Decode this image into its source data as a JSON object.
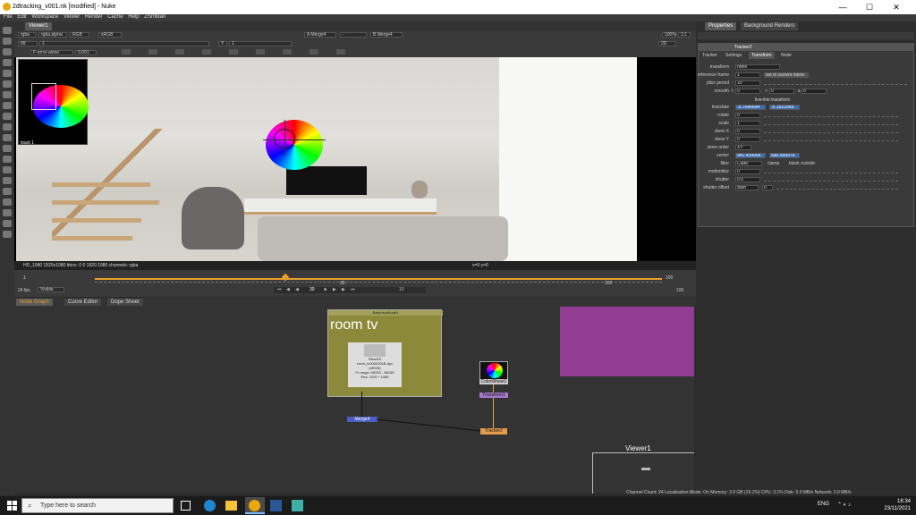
{
  "window": {
    "title": "2dtracking_v001.nk [modified] - Nuke",
    "min": "—",
    "max": "☐",
    "close": "✕"
  },
  "menu": [
    "File",
    "Edit",
    "Workspace",
    "Viewer",
    "Render",
    "Cache",
    "Help",
    "ZSmbian"
  ],
  "viewer": {
    "tab": "Viewer1",
    "channels": "rgba",
    "alpha": "rgba.alpha",
    "colorspace": "RGB",
    "display": "sRGB",
    "a_input": "A  Merge4",
    "a_op": "-",
    "b_input": "B  Merge4",
    "zoom": "100%",
    "ratio": "1:1",
    "f_stop": "f/8",
    "frame_val": "1",
    "gain": "Y",
    "gamma": "1",
    "mode": "2D",
    "proxy_mode": "F-error-alone",
    "offset": "0.001",
    "thumb_label": "track 1",
    "status_left": "HD_1080 1920x1080  bbox: 0 0 1920 1080 channels: rgba",
    "status_right": "x=0 y=0"
  },
  "timeline": {
    "fps": "24 fps",
    "visible": "Visible",
    "start": "1",
    "end": "100",
    "current": "30",
    "marks": [
      "10",
      "20",
      "30",
      "40",
      "50",
      "60",
      "70",
      "80",
      "90",
      "100"
    ],
    "in_frame": "1",
    "out_frame": "100",
    "step": "10"
  },
  "panels": {
    "tabs": [
      "Node Graph",
      "Curve Editor",
      "Dope Sheet"
    ]
  },
  "nodes": {
    "backdrop_name": "BackdropNode1",
    "backdrop_label": "room tv",
    "read_name": "Read23",
    "read_file": "room_tv0000001B.dpx",
    "read_colorspace": "(sRGB)",
    "read_frames": "Fr range: 90000 - 86155",
    "read_res": "Res: 1920 * 1080",
    "merge_name": "Merge4",
    "checker_name": "ColorWheel1",
    "transform_name": "Transform1",
    "tracker_name": "Tracker2",
    "viewer_name": "Viewer1",
    "colorwheel_label": "ColorWheel1"
  },
  "properties": {
    "tabs": [
      "Properties",
      "Background Renders"
    ],
    "node_name": "Tracker2",
    "node_tabs": [
      "Tracker",
      "Settings",
      "Transform",
      "Node"
    ],
    "rows": [
      {
        "label": "transform",
        "value": "none"
      },
      {
        "label": "reference frame",
        "value": "1",
        "button": "set to current frame"
      },
      {
        "label": "jitter period",
        "value": "10"
      },
      {
        "label": "smooth",
        "t": "0",
        "r": "0",
        "s": "0"
      },
      {
        "label": "",
        "section": "live-link transform"
      },
      {
        "label": "translate",
        "x": "-5.7640694",
        "y": "-6.1522069"
      },
      {
        "label": "rotate",
        "value": "0"
      },
      {
        "label": "scale",
        "value": "1"
      },
      {
        "label": "skew X",
        "value": "0"
      },
      {
        "label": "skew Y",
        "value": "0"
      },
      {
        "label": "skew order",
        "value": "XY"
      },
      {
        "label": "center",
        "x": "941.439906",
        "y": "590.599979"
      },
      {
        "label": "filter",
        "value": "Cubic",
        "clamp": "clamp",
        "black_outside": "black outside"
      },
      {
        "label": "motionblur",
        "value": "0"
      },
      {
        "label": "shutter",
        "value": "0.5"
      },
      {
        "label": "shutter offset",
        "value": "start",
        "extra": "0"
      }
    ],
    "smooth_t": "t",
    "smooth_r": "r",
    "smooth_s": "s"
  },
  "statusline": "Channel Count: 24  Localization Mode: On  Memory: 3.0 GB (19.1%)  CPU: 3.1%  Disk: 0.0 MB/s  Network: 0.0 MB/s",
  "taskbar": {
    "search_placeholder": "Type here to search",
    "time": "18:34",
    "date": "23/11/2021",
    "lang": "ENG",
    "apps": [
      "task-view",
      "edge",
      "file-explorer",
      "nuke",
      "word",
      "app"
    ]
  },
  "colors": {
    "backdrop": "#8c8a3a",
    "purple_backdrop": "#933c94",
    "tracker": "#e39b4c",
    "merge": "#4a5fc4",
    "selection": "#3c6eb4"
  }
}
